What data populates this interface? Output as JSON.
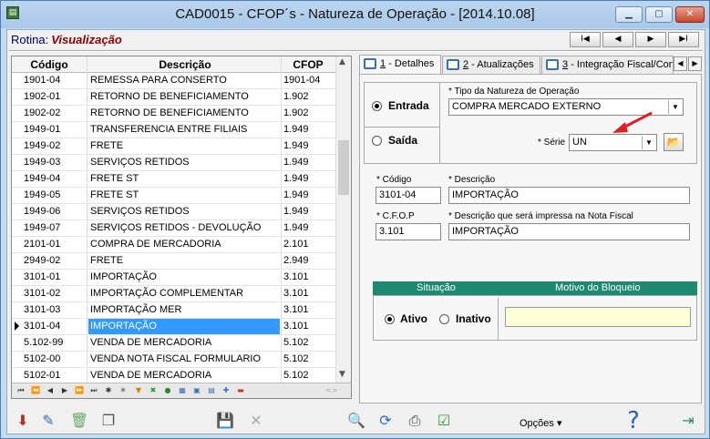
{
  "window": {
    "title": "CAD0015 - CFOP´s - Natureza de Operação - [2014.10.08]"
  },
  "rotina": {
    "label": "Rotina:",
    "mode": "Visualização"
  },
  "nav": {
    "first": "I◀",
    "prev": "◀",
    "next": "▶",
    "last": "▶I"
  },
  "grid": {
    "headers": {
      "codigo": "Código",
      "descricao": "Descrição",
      "cfop": "CFOP"
    },
    "rows": [
      {
        "codigo": "1901-04",
        "descricao": "REMESSA PARA CONSERTO",
        "cfop": "1901-04"
      },
      {
        "codigo": "1902-01",
        "descricao": "RETORNO DE BENEFICIAMENTO",
        "cfop": "1.902"
      },
      {
        "codigo": "1902-02",
        "descricao": "RETORNO DE BENEFICIAMENTO",
        "cfop": "1.902"
      },
      {
        "codigo": "1949-01",
        "descricao": "TRANSFERENCIA ENTRE FILIAIS",
        "cfop": "1.949"
      },
      {
        "codigo": "1949-02",
        "descricao": "FRETE",
        "cfop": "1.949"
      },
      {
        "codigo": "1949-03",
        "descricao": "SERVIÇOS RETIDOS",
        "cfop": "1.949"
      },
      {
        "codigo": "1949-04",
        "descricao": "FRETE ST",
        "cfop": "1.949"
      },
      {
        "codigo": "1949-05",
        "descricao": "FRETE ST",
        "cfop": "1.949"
      },
      {
        "codigo": "1949-06",
        "descricao": "SERVIÇOS RETIDOS",
        "cfop": "1.949"
      },
      {
        "codigo": "1949-07",
        "descricao": "SERVIÇOS RETIDOS - DEVOLUÇÃO",
        "cfop": "1.949"
      },
      {
        "codigo": "2101-01",
        "descricao": "COMPRA DE MERCADORIA",
        "cfop": "2.101"
      },
      {
        "codigo": "2949-02",
        "descricao": "FRETE",
        "cfop": "2.949"
      },
      {
        "codigo": "3101-01",
        "descricao": "IMPORTAÇÃO",
        "cfop": "3.101"
      },
      {
        "codigo": "3101-02",
        "descricao": "IMPORTAÇÃO COMPLEMENTAR",
        "cfop": "3.101"
      },
      {
        "codigo": "3101-03",
        "descricao": "IMPORTAÇÃO MER",
        "cfop": "3.101"
      },
      {
        "codigo": "3101-04",
        "descricao": "IMPORTAÇÃO",
        "cfop": "3.101"
      },
      {
        "codigo": "5.102-99",
        "descricao": "VENDA DE MERCADORIA",
        "cfop": "5.102"
      },
      {
        "codigo": "5102-00",
        "descricao": "VENDA NOTA FISCAL FORMULARIO",
        "cfop": "5.102"
      },
      {
        "codigo": "5102-01",
        "descricao": "VENDA DE MERCADORIA",
        "cfop": "5.102"
      }
    ]
  },
  "tabs": [
    {
      "num": "1",
      "label": " - Detalhes"
    },
    {
      "num": "2",
      "label": " - Atualizações"
    },
    {
      "num": "3",
      "label": " - Integração Fiscal/Con"
    }
  ],
  "details": {
    "entrada_label": "Entrada",
    "saida_label": "Saída",
    "tipo_label": "* Tipo da Natureza de Operação",
    "tipo_value": "COMPRA MERCADO EXTERNO",
    "serie_label": "* Série",
    "serie_value": "UN",
    "codigo_label": "* Código",
    "codigo_value": "3101-04",
    "descricao_label": "* Descrição",
    "descricao_value": "IMPORTAÇÃO",
    "cfop_label": "* C.F.O.P",
    "cfop_value": "3.101",
    "descricao_nf_label": "* Descrição que será impressa na Nota Fiscal",
    "descricao_nf_value": "IMPORTAÇÃO",
    "situacao_label": "Situação",
    "motivo_label": "Motivo do Bloqueio",
    "ativo_label": "Ativo",
    "inativo_label": "Inativo",
    "motivo_value": ""
  },
  "footer": {
    "opcoes_label": "Opções ▾"
  },
  "colors": {
    "selection": "#3399ff",
    "status_bar": "#1b8a6e",
    "motivo_bg": "#ffffd8",
    "mode_text": "#8b0000"
  }
}
